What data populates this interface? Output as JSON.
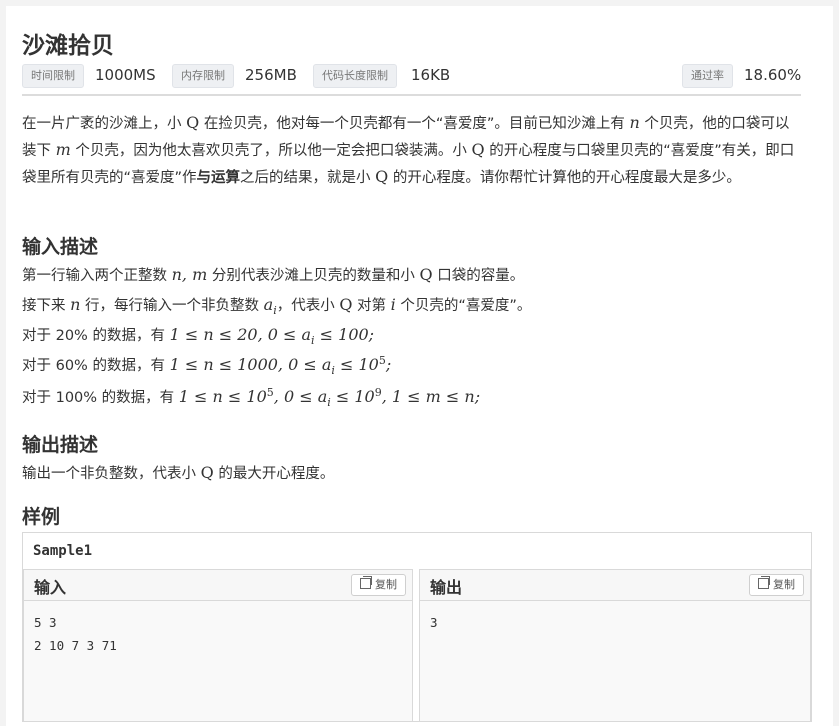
{
  "problem": {
    "title": "沙滩拾贝",
    "meta": {
      "time_label": "时间限制",
      "time_value": "1000MS",
      "mem_label": "内存限制",
      "mem_value": "256MB",
      "code_label": "代码长度限制",
      "code_value": "16KB",
      "pass_label": "通过率",
      "pass_value": "18.60%"
    },
    "description": {
      "p1": "在一片广袤的沙滩上，小 ",
      "q": "Q",
      "p2": " 在捡贝壳，他对每一个贝壳都有一个“喜爱度”。目前已知沙滩上有 ",
      "n": "n",
      "p3": " 个贝壳，他的口袋可以装下 ",
      "m": "m",
      "p4": " 个贝壳，因为他太喜欢贝壳了，所以他一定会把口袋装满。小 ",
      "p5": " 的开心程度与口袋里贝壳的“喜爱度”有关，即口袋里所有贝壳的“喜爱度”作",
      "bold": "与运算",
      "p6": "之后的结果，就是小 ",
      "p7": " 的开心程度。请你帮忙计算他的开心程度最大是多少。"
    },
    "input_heading": "输入描述",
    "input_lines": {
      "l1a": "第一行输入两个正整数 ",
      "l1m": "n, m",
      "l1b": " 分别代表沙滩上贝壳的数量和小 ",
      "l1c": " 口袋的容量。",
      "l2a": "接下来 ",
      "l2b": " 行，每行输入一个非负整数 ",
      "l2ai": "a",
      "l2sub": "i",
      "l2c": "，代表小 ",
      "l2d": " 对第 ",
      "l2i": "i",
      "l2e": " 个贝壳的“喜爱度”。",
      "l3a": "对于 20% 的数据，有 ",
      "l3m": "1 ≤ n ≤ 20, 0 ≤ a",
      "l3m2": " ≤ 100;",
      "l4a": "对于 60% 的数据，有 ",
      "l4m": "1 ≤ n ≤ 1000, 0 ≤ a",
      "l4m2": " ≤ 10",
      "l4exp": "5",
      "l4end": ";",
      "l5a": "对于 100% 的数据，有 ",
      "l5m": "1 ≤ n ≤ 10",
      "l5exp": "5",
      "l5m2": ", 0 ≤ a",
      "l5m3": " ≤ 10",
      "l5exp2": "9",
      "l5m4": ", 1 ≤ m ≤ n;"
    },
    "output_heading": "输出描述",
    "output_line": {
      "a": "输出一个非负整数，代表小 ",
      "b": " 的最大开心程度。"
    },
    "sample_heading": "样例",
    "sample": {
      "name": "Sample1",
      "input_label": "输入",
      "output_label": "输出",
      "copy_label": "复制",
      "input_text": "5 3\n2 10 7 3 71",
      "output_text": "3"
    }
  }
}
